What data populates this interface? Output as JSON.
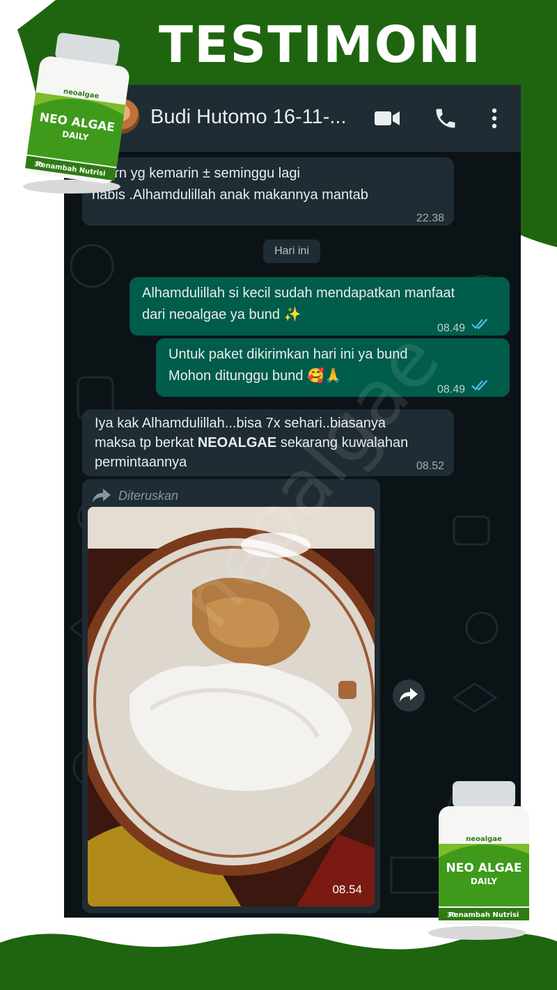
{
  "banner": {
    "title": "TESTIMONI"
  },
  "chat": {
    "contact_name": "Budi Hutomo 16-11-...",
    "messages": [
      {
        "direction": "incoming",
        "lines": [
          "1..krn yg kemarin ± seminggu lagi",
          "habis .Alhamdulillah anak   makannya mantab"
        ],
        "time": "22.38"
      },
      {
        "direction": "outgoing",
        "lines": [
          "Alhamdulillah si kecil sudah mendapatkan manfaat",
          "dari neoalgae ya bund ✨"
        ],
        "time": "08.49"
      },
      {
        "direction": "outgoing",
        "lines": [
          "Untuk paket dikirimkan hari ini ya bund",
          "Mohon ditunggu bund 🥰🙏"
        ],
        "time": "08.49"
      },
      {
        "direction": "incoming",
        "lines": [
          "Iya kak Alhamdulillah...bisa 7x sehari..biasanya",
          "maksa tp berkat ",
          "NEOALGAE",
          " sekarang kuwalahan",
          "permintaannya"
        ],
        "time": "08.52"
      }
    ],
    "day_separator": "Hari ini",
    "forwarded": {
      "label": "Diteruskan",
      "time": "08.54"
    }
  },
  "watermark": "neoalgae",
  "product": {
    "brand": "neoalgae",
    "name": "NEO ALGAE",
    "variant": "DAILY",
    "tagline": "Penambah Nutrisi",
    "count": "30"
  },
  "colors": {
    "brand_green": "#1f6510",
    "outgoing_bubble": "#005c4b",
    "incoming_bubble": "#1f2c33",
    "read_tick": "#53bdeb"
  }
}
